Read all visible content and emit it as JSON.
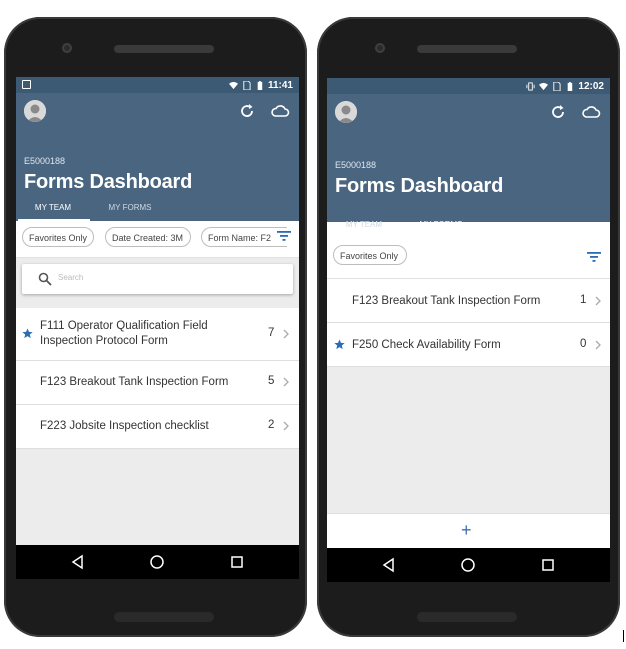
{
  "colors": {
    "header_bg": "#4a6580",
    "status_bg": "#3d5a75",
    "list_bg": "#ececec",
    "star": "#2a6db5",
    "filter_icon": "#2a6db5"
  },
  "phones": [
    {
      "status": {
        "time": "11:41"
      },
      "header": {
        "employee_id": "E5000188",
        "title": "Forms Dashboard",
        "tabs": [
          {
            "label": "MY TEAM",
            "active": true
          },
          {
            "label": "MY FORMS",
            "active": false
          }
        ]
      },
      "filters": [
        "Favorites Only",
        "Date Created: 3M",
        "Form Name: F2"
      ],
      "search": {
        "placeholder": "Search"
      },
      "rows": [
        {
          "favorite": true,
          "line1": "F111 Operator Qualification Field",
          "line2": "Inspection Protocol Form",
          "count": "7"
        },
        {
          "favorite": false,
          "line1": "F123 Breakout Tank Inspection Form",
          "line2": "",
          "count": "5"
        },
        {
          "favorite": false,
          "line1": "F223 Jobsite Inspection checklist",
          "line2": "",
          "count": "2"
        }
      ]
    },
    {
      "status": {
        "time": "12:02"
      },
      "header": {
        "employee_id": "E5000188",
        "title": "Forms Dashboard",
        "tabs": [
          {
            "label": "MY TEAM",
            "active": false
          },
          {
            "label": "MY FORMS",
            "active": true
          }
        ]
      },
      "filters": [
        "Favorites Only"
      ],
      "rows": [
        {
          "favorite": false,
          "line1": "F123 Breakout Tank Inspection Form",
          "line2": "",
          "count": "1"
        },
        {
          "favorite": true,
          "line1": "F250 Check Availability Form",
          "line2": "",
          "count": "0"
        }
      ],
      "fab": {
        "label": "+"
      }
    }
  ]
}
